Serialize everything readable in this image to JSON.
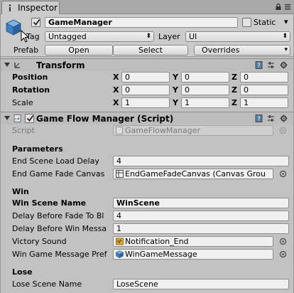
{
  "tab": {
    "label": "Inspector"
  },
  "gameobject": {
    "name": "GameManager",
    "active": true,
    "static_label": "Static",
    "tag_label": "Tag",
    "tag_value": "Untagged",
    "layer_label": "Layer",
    "layer_value": "UI",
    "prefab_label": "Prefab",
    "prefab_buttons": {
      "open": "Open",
      "select": "Select",
      "overrides": "Overrides"
    }
  },
  "transform": {
    "title": "Transform",
    "rows": [
      {
        "label": "Position",
        "x": "0",
        "y": "0",
        "z": "0"
      },
      {
        "label": "Rotation",
        "x": "0",
        "y": "0",
        "z": "0"
      },
      {
        "label": "Scale",
        "x": "1",
        "y": "1",
        "z": "1"
      }
    ],
    "axis_x": "X",
    "axis_y": "Y",
    "axis_z": "Z"
  },
  "script_component": {
    "title": "Game Flow Manager (Script)",
    "enabled": true,
    "script_label": "Script",
    "script_value": "GameFlowManager",
    "sections": {
      "parameters": "Parameters",
      "win": "Win",
      "lose": "Lose"
    },
    "fields": {
      "end_scene_load_delay_label": "End Scene Load Delay",
      "end_scene_load_delay_value": "4",
      "end_game_fade_canvas_label": "End Game Fade Canvas",
      "end_game_fade_canvas_value": "EndGameFadeCanvas (Canvas Grou",
      "win_scene_name_label": "Win Scene Name",
      "win_scene_name_value": "WinScene",
      "delay_before_fade_label": "Delay Before Fade To Bl",
      "delay_before_fade_value": "4",
      "delay_before_win_message_label": "Delay Before Win Messa",
      "delay_before_win_message_value": "1",
      "victory_sound_label": "Victory Sound",
      "victory_sound_value": "Notification_End",
      "win_game_message_label": "Win Game Message Pref",
      "win_game_message_value": "WinGameMessage",
      "lose_scene_name_label": "Lose Scene Name",
      "lose_scene_name_value": "LoseScene"
    }
  },
  "colors": {
    "background": "#c2c2c2",
    "field_bg": "#f0f0f0",
    "header_bg": "#bdbdbd"
  }
}
